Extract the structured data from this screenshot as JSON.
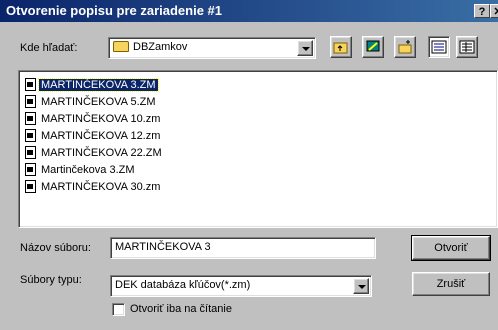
{
  "window": {
    "title": "Otvorenie popisu pre zariadenie #1",
    "help_button": "?",
    "close_button": "✕"
  },
  "lookin": {
    "label": "Kde hľadať:",
    "value": "DBZamkov"
  },
  "toolbar": {
    "icons": [
      "up-folder-icon",
      "desktop-icon",
      "new-folder-icon",
      "list-view-icon",
      "details-view-icon"
    ]
  },
  "files": [
    "MARTINČEKOVA  3.ZM",
    "MARTINČEKOVA  5.ZM",
    "MARTINČEKOVA 10.zm",
    "MARTINČEKOVA 12.zm",
    "MARTINČEKOVA 22.ZM",
    "Martinčekova 3.ZM",
    "MARTINČEKOVA 30.zm"
  ],
  "selected_index": 0,
  "filename": {
    "label": "Názov súboru:",
    "value": "MARTINČEKOVA  3"
  },
  "filetype": {
    "label": "Súbory typu:",
    "value": "DEK databáza kľúčov(*.zm)"
  },
  "readonly": {
    "label": "Otvoriť iba na čítanie",
    "checked": false
  },
  "buttons": {
    "open": "Otvoriť",
    "cancel": "Zrušiť"
  }
}
